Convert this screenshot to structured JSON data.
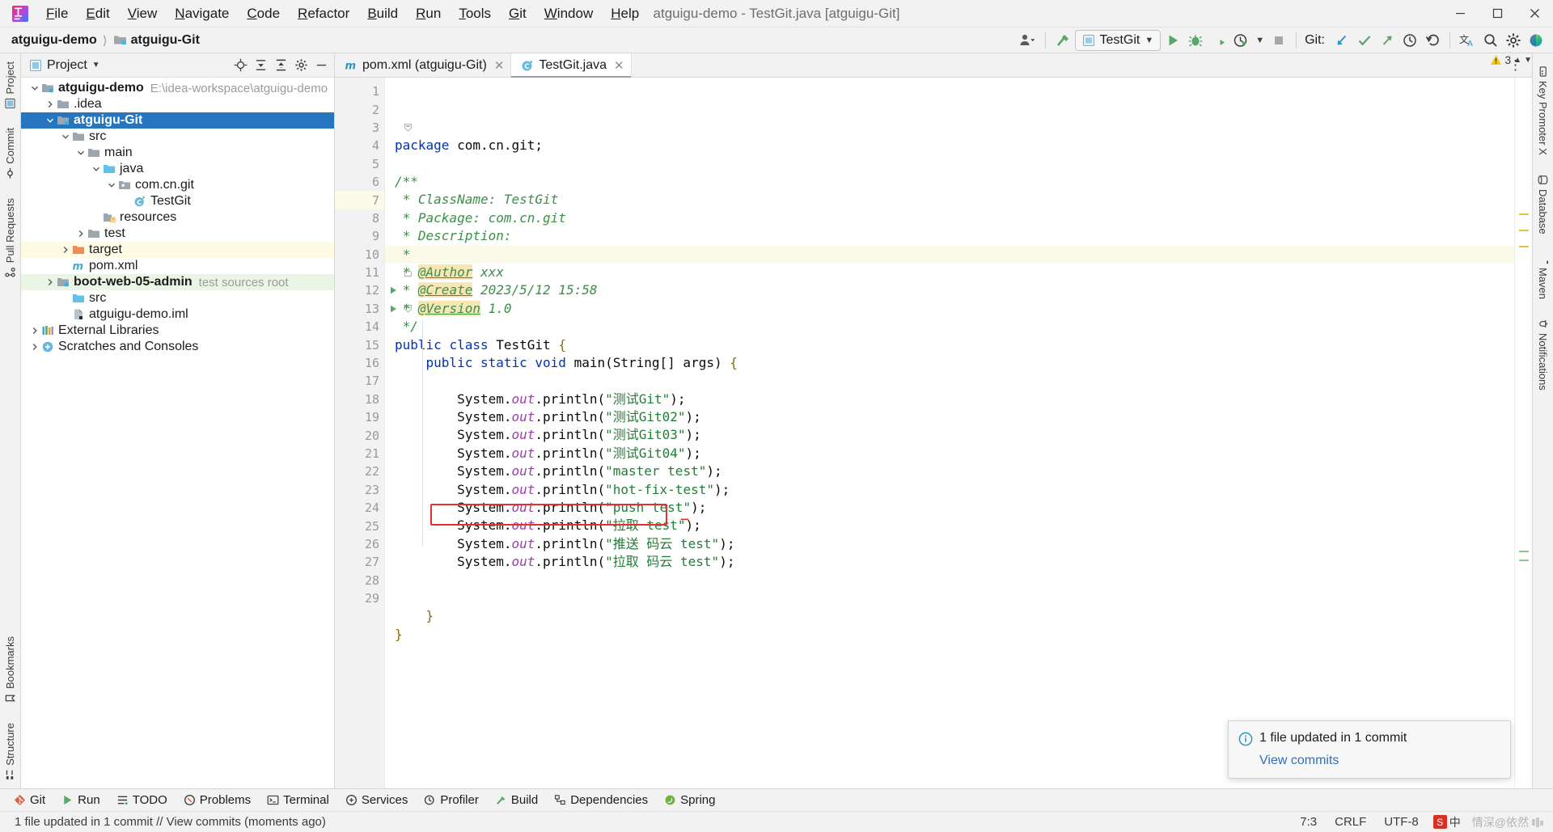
{
  "window": {
    "title": "atguigu-demo - TestGit.java [atguigu-Git]",
    "minimize_label": "Minimize",
    "maximize_label": "Maximize",
    "close_label": "Close"
  },
  "menu": {
    "items": [
      {
        "label": "File",
        "mnemonic": "F"
      },
      {
        "label": "Edit",
        "mnemonic": "E"
      },
      {
        "label": "View",
        "mnemonic": "V"
      },
      {
        "label": "Navigate",
        "mnemonic": "N"
      },
      {
        "label": "Code",
        "mnemonic": "C"
      },
      {
        "label": "Refactor",
        "mnemonic": "R"
      },
      {
        "label": "Build",
        "mnemonic": "B"
      },
      {
        "label": "Run",
        "mnemonic": "R"
      },
      {
        "label": "Tools",
        "mnemonic": "T"
      },
      {
        "label": "Git",
        "mnemonic": "G"
      },
      {
        "label": "Window",
        "mnemonic": "W"
      },
      {
        "label": "Help",
        "mnemonic": "H"
      }
    ]
  },
  "navbar": {
    "breadcrumb": [
      {
        "label": "atguigu-demo",
        "icon": "module-icon"
      },
      {
        "label": "atguigu-Git",
        "icon": "module-icon"
      }
    ],
    "run_config": "TestGit",
    "git_label": "Git:",
    "toolbar_icons": [
      "account-icon",
      "build-icon",
      "run-icon",
      "debug-icon",
      "run-with-coverage-icon",
      "profiler-icon",
      "stop-icon",
      "git-update-icon",
      "git-commit-icon",
      "git-push-icon",
      "git-history-icon",
      "git-rollback-icon",
      "translate-icon",
      "search-everywhere-icon",
      "settings-icon",
      "ide-assistant-icon"
    ]
  },
  "left_rail": {
    "top": [
      "Project",
      "Commit",
      "Pull Requests"
    ],
    "bottom": [
      "Bookmarks",
      "Structure"
    ]
  },
  "right_rail": {
    "items": [
      "Key Promoter X",
      "Database",
      "Maven",
      "Notifications"
    ]
  },
  "project_panel": {
    "title": "Project",
    "actions": [
      "locate-icon",
      "collapse-all-icon",
      "expand-icon",
      "settings-icon",
      "hide-icon"
    ],
    "tree": [
      {
        "depth": 0,
        "arrow": "down",
        "icon": "module-root-icon",
        "label": "atguigu-demo",
        "bold": true,
        "sub": "E:\\idea-workspace\\atguigu-demo",
        "state": "normal"
      },
      {
        "depth": 1,
        "arrow": "right",
        "icon": "folder-icon",
        "label": ".idea",
        "bold": false,
        "sub": "",
        "state": "normal"
      },
      {
        "depth": 1,
        "arrow": "down",
        "icon": "module-root-icon",
        "label": "atguigu-Git",
        "bold": true,
        "sub": "",
        "state": "selected"
      },
      {
        "depth": 2,
        "arrow": "down",
        "icon": "folder-icon",
        "label": "src",
        "bold": false,
        "sub": "",
        "state": "normal"
      },
      {
        "depth": 3,
        "arrow": "down",
        "icon": "folder-icon",
        "label": "main",
        "bold": false,
        "sub": "",
        "state": "normal"
      },
      {
        "depth": 4,
        "arrow": "down",
        "icon": "source-folder-icon",
        "label": "java",
        "bold": false,
        "sub": "",
        "state": "normal"
      },
      {
        "depth": 5,
        "arrow": "down",
        "icon": "package-icon",
        "label": "com.cn.git",
        "bold": false,
        "sub": "",
        "state": "normal"
      },
      {
        "depth": 6,
        "arrow": "none",
        "icon": "java-class-icon",
        "label": "TestGit",
        "bold": false,
        "sub": "",
        "state": "normal"
      },
      {
        "depth": 4,
        "arrow": "none",
        "icon": "resources-folder-icon",
        "label": "resources",
        "bold": false,
        "sub": "",
        "state": "normal"
      },
      {
        "depth": 3,
        "arrow": "right",
        "icon": "folder-icon",
        "label": "test",
        "bold": false,
        "sub": "",
        "state": "normal"
      },
      {
        "depth": 2,
        "arrow": "right",
        "icon": "excluded-folder-icon",
        "label": "target",
        "bold": false,
        "sub": "",
        "state": "yellow"
      },
      {
        "depth": 2,
        "arrow": "none",
        "icon": "maven-file-icon",
        "label": "pom.xml",
        "bold": false,
        "sub": "",
        "state": "normal"
      },
      {
        "depth": 1,
        "arrow": "right",
        "icon": "module-root-icon",
        "label": "boot-web-05-admin",
        "bold": true,
        "sub": "test sources root",
        "state": "green"
      },
      {
        "depth": 2,
        "arrow": "none",
        "icon": "source-folder-icon",
        "label": "src",
        "bold": false,
        "sub": "",
        "state": "normal"
      },
      {
        "depth": 2,
        "arrow": "none",
        "icon": "iml-file-icon",
        "label": "atguigu-demo.iml",
        "bold": false,
        "sub": "",
        "state": "normal"
      },
      {
        "depth": 0,
        "arrow": "right",
        "icon": "libraries-icon",
        "label": "External Libraries",
        "bold": false,
        "sub": "",
        "state": "normal"
      },
      {
        "depth": 0,
        "arrow": "right",
        "icon": "scratches-icon",
        "label": "Scratches and Consoles",
        "bold": false,
        "sub": "",
        "state": "normal"
      }
    ]
  },
  "editor": {
    "tabs": [
      {
        "label": "pom.xml (atguigu-Git)",
        "icon": "maven-file-icon",
        "active": false
      },
      {
        "label": "TestGit.java",
        "icon": "java-class-icon",
        "active": true
      }
    ],
    "inspection_count": "3",
    "lines": [
      {
        "n": "1",
        "text": "package com.cn.git;"
      },
      {
        "n": "2",
        "text": ""
      },
      {
        "n": "3",
        "text": "/**"
      },
      {
        "n": "4",
        "text": " * ClassName: TestGit"
      },
      {
        "n": "5",
        "text": " * Package: com.cn.git"
      },
      {
        "n": "6",
        "text": " * Description:"
      },
      {
        "n": "7",
        "text": " *"
      },
      {
        "n": "8",
        "text": " * @Author xxx"
      },
      {
        "n": "9",
        "text": " * @Create 2023/5/12 15:58"
      },
      {
        "n": "10",
        "text": " * @Version 1.0"
      },
      {
        "n": "11",
        "text": " */"
      },
      {
        "n": "12",
        "text": "public class TestGit {"
      },
      {
        "n": "13",
        "text": "    public static void main(String[] args) {"
      },
      {
        "n": "14",
        "text": ""
      },
      {
        "n": "15",
        "text": "        System.out.println(\"测试Git\");"
      },
      {
        "n": "16",
        "text": "        System.out.println(\"测试Git02\");"
      },
      {
        "n": "17",
        "text": "        System.out.println(\"测试Git03\");"
      },
      {
        "n": "18",
        "text": "        System.out.println(\"测试Git04\");"
      },
      {
        "n": "19",
        "text": "        System.out.println(\"master test\");"
      },
      {
        "n": "20",
        "text": "        System.out.println(\"hot-fix-test\");"
      },
      {
        "n": "21",
        "text": "        System.out.println(\"push test\");"
      },
      {
        "n": "22",
        "text": "        System.out.println(\"拉取 test\");"
      },
      {
        "n": "23",
        "text": "        System.out.println(\"推送 码云 test\");"
      },
      {
        "n": "24",
        "text": "        System.out.println(\"拉取 码云 test\");"
      },
      {
        "n": "25",
        "text": ""
      },
      {
        "n": "26",
        "text": ""
      },
      {
        "n": "27",
        "text": "    }"
      },
      {
        "n": "28",
        "text": "}"
      },
      {
        "n": "29",
        "text": ""
      }
    ],
    "cursor_line": "7",
    "highlight_box_line": "24"
  },
  "notification": {
    "icon": "info-icon",
    "message": "1 file updated in 1 commit",
    "link": "View commits"
  },
  "toolwindows": [
    {
      "label": "Git",
      "icon": "git-icon"
    },
    {
      "label": "Run",
      "icon": "run-icon"
    },
    {
      "label": "TODO",
      "icon": "todo-icon"
    },
    {
      "label": "Problems",
      "icon": "problems-icon"
    },
    {
      "label": "Terminal",
      "icon": "terminal-icon"
    },
    {
      "label": "Services",
      "icon": "services-icon"
    },
    {
      "label": "Profiler",
      "icon": "profiler-icon"
    },
    {
      "label": "Build",
      "icon": "build-icon"
    },
    {
      "label": "Dependencies",
      "icon": "dependencies-icon"
    },
    {
      "label": "Spring",
      "icon": "spring-icon"
    }
  ],
  "statusbar": {
    "message": "1 file updated in 1 commit // View commits (moments ago)",
    "caret": "7:3",
    "line_separator": "CRLF",
    "encoding": "UTF-8",
    "ime": "中",
    "watermark": "情深@依然"
  },
  "colors": {
    "selection_blue": "#2675bf",
    "excluded_yellow": "#fdfbe3",
    "test_green": "#eaf5e5",
    "caret_row": "#fcfae8",
    "red_box": "#e03131",
    "link_blue": "#2f6fbf",
    "keyword_blue": "#0033b3",
    "string_green": "#227d36",
    "comment_green": "#3d8f4a",
    "field_purple": "#9b3fab"
  }
}
